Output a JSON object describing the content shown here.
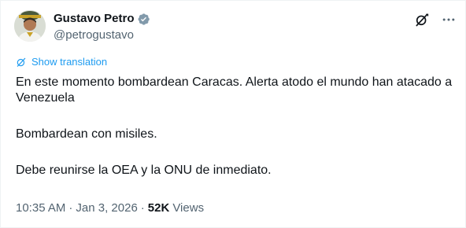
{
  "author": {
    "display_name": "Gustavo Petro",
    "handle": "@petrogustavo",
    "verified_color": "#829aab",
    "avatar_icon": "profile-photo"
  },
  "actions": {
    "grok_icon": "grok-icon",
    "more_icon": "more-horizontal-icon"
  },
  "translate": {
    "icon": "globe-icon",
    "label": "Show translation",
    "color": "#1d9bf0"
  },
  "tweet": {
    "paragraphs": [
      "En este momento bombardean Caracas. Alerta atodo el mundo han atacado a Venezuela",
      "Bombardean con misiles.",
      "Debe reunirse la OEA y la ONU de inmediato."
    ]
  },
  "meta": {
    "time": "10:35 AM",
    "separator": "·",
    "date": "Jan 3, 2026",
    "views_count": "52K",
    "views_label": "Views"
  }
}
